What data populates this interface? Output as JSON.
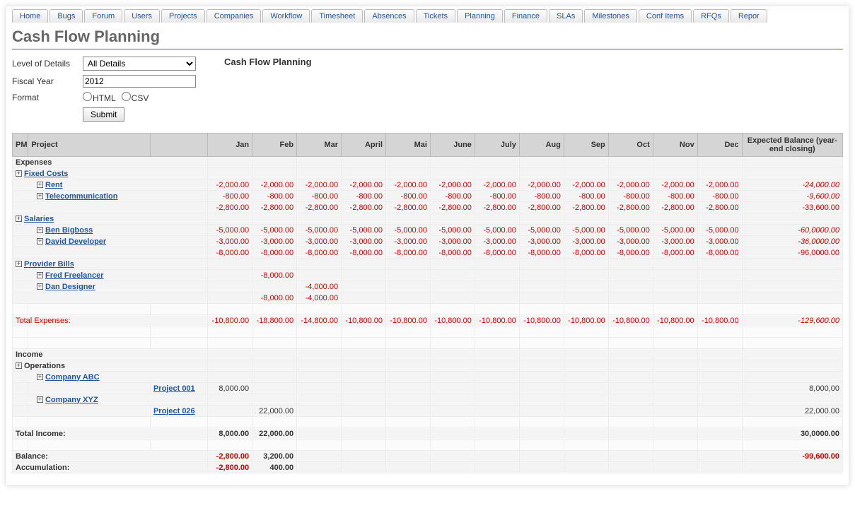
{
  "tabs": [
    "Home",
    "Bugs",
    "Forum",
    "Users",
    "Projects",
    "Companies",
    "Workflow",
    "Timesheet",
    "Absences",
    "Tickets",
    "Planning",
    "Finance",
    "SLAs",
    "Milestones",
    "Conf Items",
    "RFQs",
    "Repor"
  ],
  "page_title": "Cash Flow Planning",
  "section_title": "Cash Flow Planning",
  "form": {
    "level_label": "Level of Details",
    "level_value": "All Details",
    "year_label": "Fiscal Year",
    "year_value": "2012",
    "format_label": "Format",
    "format_html": "HTML",
    "format_csv": "CSV",
    "submit": "Submit"
  },
  "headers": {
    "pm": "PM",
    "project": "Project",
    "months": [
      "Jan",
      "Feb",
      "Mar",
      "April",
      "Mai",
      "June",
      "July",
      "Aug",
      "Sep",
      "Oct",
      "Nov",
      "Dec"
    ],
    "balance": "Expected Balance (year-end closing)"
  },
  "sections": {
    "expenses": "Expenses",
    "fixed_costs": "Fixed Costs",
    "rent": "Rent",
    "telecom": "Telecommunication",
    "salaries": "Salaries",
    "ben": "Ben Bigboss",
    "david": "David Developer",
    "provider": "Provider Bills",
    "fred": "Fred Freelancer",
    "dan": "Dan Designer",
    "total_expenses": "Total Expenses:",
    "income": "Income",
    "operations": "Operations",
    "abc": "Company ABC",
    "proj001": "Project 001",
    "xyz": "Company XYZ",
    "proj026": "Project 026",
    "total_income": "Total Income:",
    "balance": "Balance:",
    "accumulation": "Accumulation:"
  },
  "values": {
    "rent": {
      "m": [
        "-2,000.00",
        "-2,000.00",
        "-2,000.00",
        "-2,000.00",
        "-2,000.00",
        "-2,000.00",
        "-2,000.00",
        "-2,000.00",
        "-2,000.00",
        "-2,000.00",
        "-2,000.00",
        "-2,000.00"
      ],
      "bal": "-24,000.00"
    },
    "telecom": {
      "m": [
        "-800.00",
        "-800.00",
        "-800.00",
        "-800.00",
        "-800.00",
        "-800.00",
        "-800.00",
        "-800.00",
        "-800.00",
        "-800.00",
        "-800.00",
        "-800.00"
      ],
      "bal": "-9,600.00"
    },
    "fixed_sub": {
      "m": [
        "-2,800.00",
        "-2,800.00",
        "-2,800.00",
        "-2,800.00",
        "-2,800.00",
        "-2,800.00",
        "-2,800.00",
        "-2,800.00",
        "-2,800.00",
        "-2,800.00",
        "-2,800.00",
        "-2,800.00"
      ],
      "bal": "-33,600.00"
    },
    "ben": {
      "m": [
        "-5,000.00",
        "-5,000.00",
        "-5,000.00",
        "-5,000.00",
        "-5,000.00",
        "-5,000.00",
        "-5,000.00",
        "-5,000.00",
        "-5,000.00",
        "-5,000.00",
        "-5,000.00",
        "-5,000.00"
      ],
      "bal": "-60,0000.00"
    },
    "david": {
      "m": [
        "-3,000.00",
        "-3,000.00",
        "-3,000.00",
        "-3,000.00",
        "-3,000.00",
        "-3,000.00",
        "-3,000.00",
        "-3,000.00",
        "-3,000.00",
        "-3,000.00",
        "-3,000.00",
        "-3,000.00"
      ],
      "bal": "-36,0000.00"
    },
    "sal_sub": {
      "m": [
        "-8,000.00",
        "-8,000.00",
        "-8,000.00",
        "-8,000.00",
        "-8,000.00",
        "-8,000.00",
        "-8,000.00",
        "-8,000.00",
        "-8,000.00",
        "-8,000.00",
        "-8,000.00",
        "-8,000.00"
      ],
      "bal": "-96,0000.00"
    },
    "fred": {
      "m": [
        "",
        "-8,000.00",
        "",
        "",
        "",
        "",
        "",
        "",
        "",
        "",
        "",
        ""
      ],
      "bal": ""
    },
    "dan": {
      "m": [
        "",
        "",
        "-4,000.00",
        "",
        "",
        "",
        "",
        "",
        "",
        "",
        "",
        ""
      ],
      "bal": ""
    },
    "prov_sub": {
      "m": [
        "",
        "-8,000.00",
        "-4,000.00",
        "",
        "",
        "",
        "",
        "",
        "",
        "",
        "",
        ""
      ],
      "bal": ""
    },
    "total_exp": {
      "m": [
        "-10,800.00",
        "-18,800.00",
        "-14,800.00",
        "-10,800.00",
        "-10,800.00",
        "-10,800.00",
        "-10,800.00",
        "-10,800.00",
        "-10,800.00",
        "-10,800.00",
        "-10,800.00",
        "-10,800.00"
      ],
      "bal": "-129,600.00"
    },
    "proj001": {
      "m": [
        "8,000.00",
        "",
        "",
        "",
        "",
        "",
        "",
        "",
        "",
        "",
        "",
        ""
      ],
      "bal": "8,000,00"
    },
    "proj026": {
      "m": [
        "",
        "22,000.00",
        "",
        "",
        "",
        "",
        "",
        "",
        "",
        "",
        "",
        ""
      ],
      "bal": "22,000.00"
    },
    "total_inc": {
      "m": [
        "8,000.00",
        "22,000.00",
        "",
        "",
        "",
        "",
        "",
        "",
        "",
        "",
        "",
        ""
      ],
      "bal": "30,0000.00"
    },
    "balance": {
      "m": [
        "-2,800.00",
        "3,200.00",
        "",
        "",
        "",
        "",
        "",
        "",
        "",
        "",
        "",
        ""
      ],
      "bal": "-99,600.00"
    },
    "accum": {
      "m": [
        "-2,800.00",
        "400.00",
        "",
        "",
        "",
        "",
        "",
        "",
        "",
        "",
        "",
        ""
      ],
      "bal": ""
    }
  }
}
